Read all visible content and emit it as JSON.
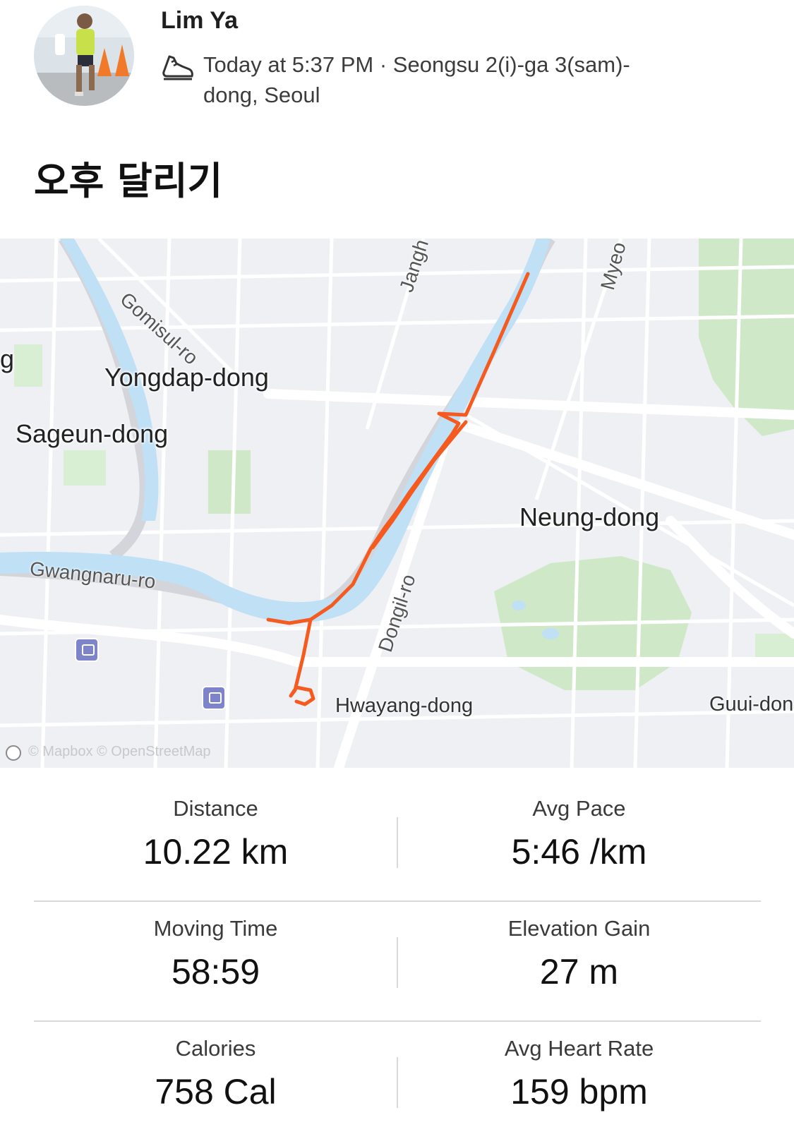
{
  "athlete": {
    "name": "Lim Ya"
  },
  "activity": {
    "meta": "Today at 5:37 PM · Seongsu 2(i)-ga 3(sam)-dong, Seoul",
    "title": "오후 달리기",
    "sport_icon": "running-shoe-icon"
  },
  "map": {
    "labels": {
      "yongdap": "Yongdap-dong",
      "sageun": "Sageun-dong",
      "neung": "Neung-dong",
      "hwayang": "Hwayang-dong",
      "guui": "Guui-don",
      "partial": "g",
      "gomisul": "Gomisul-ro",
      "jangh": "Jangh",
      "myeo": "Myeo",
      "dongil": "Dongil-ro",
      "gwangnaru": "Gwangnaru-ro"
    },
    "attribution": "© Mapbox © OpenStreetMap",
    "colors": {
      "route": "#f55a1f",
      "water": "#bfe0f5",
      "park": "#cfe9c8",
      "road": "#ffffff"
    }
  },
  "stats": [
    {
      "label": "Distance",
      "value": "10.22 km"
    },
    {
      "label": "Avg Pace",
      "value": "5:46 /km"
    },
    {
      "label": "Moving Time",
      "value": "58:59"
    },
    {
      "label": "Elevation Gain",
      "value": "27 m"
    },
    {
      "label": "Calories",
      "value": "758 Cal"
    },
    {
      "label": "Avg Heart Rate",
      "value": "159 bpm"
    }
  ]
}
